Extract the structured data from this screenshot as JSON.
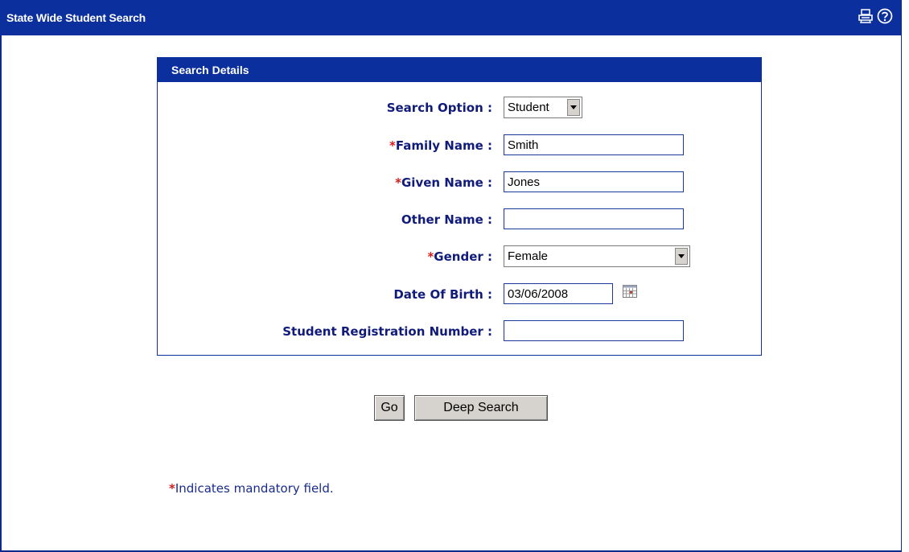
{
  "window": {
    "title": "State Wide Student Search"
  },
  "panel": {
    "title": "Search Details"
  },
  "form": {
    "search_option": {
      "label": "Search Option :",
      "value": "Student"
    },
    "family_name": {
      "required": "*",
      "label": "Family Name :",
      "value": "Smith"
    },
    "given_name": {
      "required": "*",
      "label": "Given Name :",
      "value": "Jones"
    },
    "other_name": {
      "label": "Other Name :",
      "value": ""
    },
    "gender": {
      "required": "*",
      "label": "Gender :",
      "value": "Female"
    },
    "dob": {
      "label": "Date Of Birth :",
      "value": "03/06/2008"
    },
    "srn": {
      "label": "Student Registration Number :",
      "value": ""
    }
  },
  "buttons": {
    "go": "Go",
    "deep_search": "Deep Search"
  },
  "footer": {
    "required_mark": "*",
    "note": "Indicates mandatory field."
  },
  "icons": {
    "print": "printer-icon",
    "help": "help-icon"
  },
  "colors": {
    "titlebar": "#0b2f9c",
    "label": "#101b7a",
    "required": "#d11d1d"
  }
}
